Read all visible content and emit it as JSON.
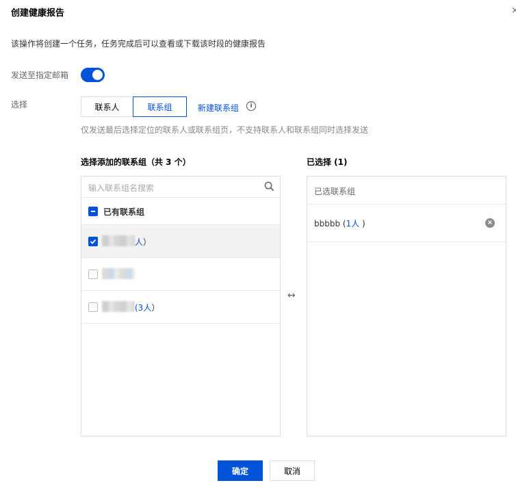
{
  "dialog": {
    "title": "创建健康报告",
    "close_glyph": "×",
    "description": "该操作将创建一个任务，任务完成后可以查看或下载该时段的健康报告"
  },
  "email": {
    "label": "发送至指定邮箱",
    "enabled": true
  },
  "select": {
    "label": "选择",
    "segments": [
      "联系人",
      "联系组"
    ],
    "active_segment": "联系组",
    "new_group_link": "新建联系组",
    "hint": "仅发送最后选择定位的联系人或联系组页，不支持联系人和联系组同时选择发送"
  },
  "left_panel": {
    "title": "选择添加的联系组（共 3 个）",
    "search_placeholder": "输入联系组名搜索",
    "group_header": "已有联系组",
    "rows": [
      {
        "name_redacted": true,
        "count": "人",
        "suffix": "）",
        "checked": true
      },
      {
        "name_redacted": true,
        "count": "",
        "suffix": "",
        "checked": false
      },
      {
        "name_redacted": true,
        "count": "(3人",
        "suffix": "）",
        "checked": false
      }
    ]
  },
  "swap_glyph": "↔",
  "right_panel": {
    "title": "已选择 (1)",
    "header": "已选联系组",
    "items": [
      {
        "name": "bbbbb (",
        "count": "1人",
        "suffix": " )"
      }
    ]
  },
  "buttons": {
    "confirm": "确定",
    "cancel": "取消"
  },
  "colors": {
    "accent": "#0052d9",
    "border": "#dcdcdc"
  },
  "icons": [
    "search-icon",
    "info-icon",
    "remove-icon",
    "swap-icon",
    "close-icon",
    "checkbox-checked",
    "checkbox-indeterminate"
  ]
}
